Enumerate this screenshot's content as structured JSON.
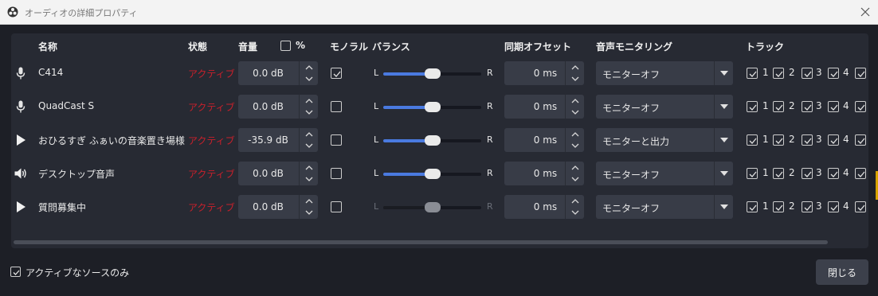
{
  "window": {
    "title": "オーディオの詳細プロパティ"
  },
  "headers": {
    "name": "名称",
    "status": "状態",
    "volume": "音量",
    "percent": "%",
    "mono": "モノラル",
    "balance": "バランス",
    "sync_offset": "同期オフセット",
    "monitoring": "音声モニタリング",
    "tracks": "トラック"
  },
  "percent_checked": false,
  "balance_labels": {
    "left": "L",
    "right": "R"
  },
  "sources": [
    {
      "icon": "microphone-icon",
      "name": "C414",
      "status": "アクティブ",
      "volume": "0.0 dB",
      "mono": true,
      "balance": 0.5,
      "balance_enabled": true,
      "sync": "0 ms",
      "monitoring": "モニターオフ",
      "tracks": [
        true,
        true,
        true,
        true,
        true
      ]
    },
    {
      "icon": "microphone-icon",
      "name": "QuadCast S",
      "status": "アクティブ",
      "volume": "0.0 dB",
      "mono": false,
      "balance": 0.5,
      "balance_enabled": true,
      "sync": "0 ms",
      "monitoring": "モニターオフ",
      "tracks": [
        true,
        true,
        true,
        true,
        true
      ]
    },
    {
      "icon": "play-icon",
      "name": "おひるすぎ ふぁいの音楽置き場様",
      "status": "アクティブ",
      "volume": "-35.9 dB",
      "mono": false,
      "balance": 0.5,
      "balance_enabled": true,
      "sync": "0 ms",
      "monitoring": "モニターと出力",
      "tracks": [
        true,
        true,
        true,
        true,
        true
      ]
    },
    {
      "icon": "speaker-icon",
      "name": "デスクトップ音声",
      "status": "アクティブ",
      "volume": "0.0 dB",
      "mono": false,
      "balance": 0.5,
      "balance_enabled": true,
      "sync": "0 ms",
      "monitoring": "モニターオフ",
      "tracks": [
        true,
        true,
        true,
        true,
        true
      ]
    },
    {
      "icon": "play-icon",
      "name": "質問募集中",
      "status": "アクティブ",
      "volume": "0.0 dB",
      "mono": false,
      "balance": 0.5,
      "balance_enabled": false,
      "sync": "0 ms",
      "monitoring": "モニターオフ",
      "tracks": [
        true,
        true,
        true,
        true,
        true
      ]
    }
  ],
  "track_numbers": [
    "1",
    "2",
    "3",
    "4"
  ],
  "footer": {
    "active_only_label": "アクティブなソースのみ",
    "active_only_checked": true,
    "close_label": "閉じる"
  },
  "colors": {
    "status_active": "#c8202b",
    "accent": "#4a7ae0",
    "background": "#1d1f26",
    "panel": "#272a33"
  }
}
